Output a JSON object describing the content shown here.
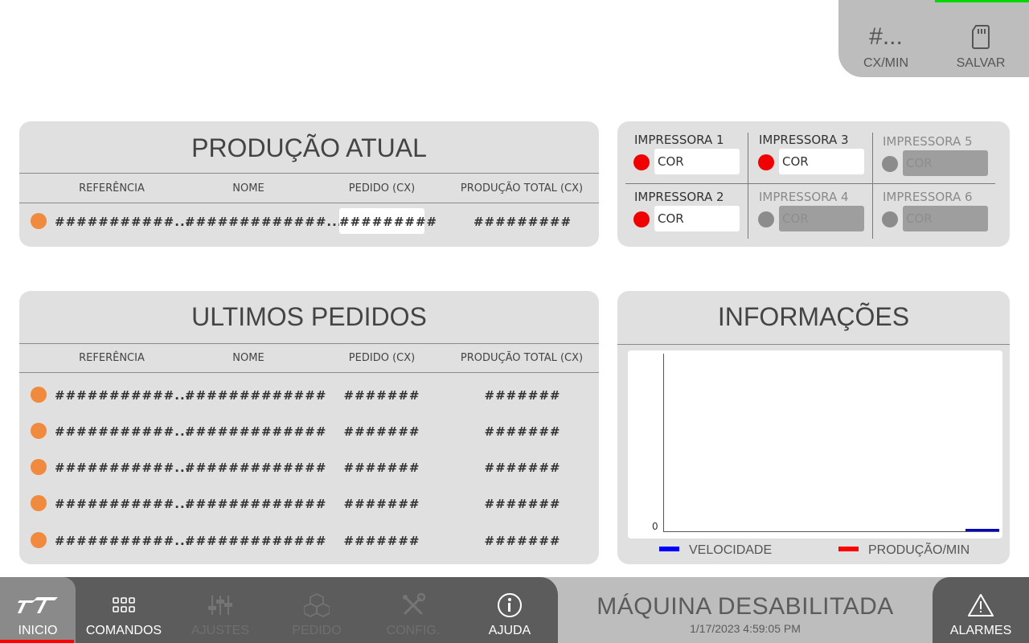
{
  "top": {
    "speed_value": "#...",
    "speed_label": "CX/MIN",
    "save_label": "SALVAR"
  },
  "producao_atual": {
    "title": "PRODUÇÃO ATUAL",
    "headers": [
      "REFERÊNCIA",
      "NOME",
      "PEDIDO (CX)",
      "PRODUÇÃO TOTAL (CX)"
    ],
    "row": {
      "referencia": "###########...",
      "nome": "#############...",
      "pedido": "#########",
      "total": "#########"
    }
  },
  "impressoras": [
    {
      "name": "IMPRESSORA 1",
      "cor": "COR",
      "enabled": true
    },
    {
      "name": "IMPRESSORA 2",
      "cor": "COR",
      "enabled": true
    },
    {
      "name": "IMPRESSORA 3",
      "cor": "COR",
      "enabled": true
    },
    {
      "name": "IMPRESSORA 4",
      "cor": "COR",
      "enabled": false
    },
    {
      "name": "IMPRESSORA 5",
      "cor": "COR",
      "enabled": false
    },
    {
      "name": "IMPRESSORA 6",
      "cor": "COR",
      "enabled": false
    }
  ],
  "ultimos_pedidos": {
    "title": "ULTIMOS PEDIDOS",
    "headers": [
      "REFERÊNCIA",
      "NOME",
      "PEDIDO (CX)",
      "PRODUÇÃO TOTAL (CX)"
    ],
    "rows": [
      {
        "referencia": "###########...",
        "nome": "#############",
        "pedido": "#######",
        "total": "#######"
      },
      {
        "referencia": "###########...",
        "nome": "#############",
        "pedido": "#######",
        "total": "#######"
      },
      {
        "referencia": "###########...",
        "nome": "#############",
        "pedido": "#######",
        "total": "#######"
      },
      {
        "referencia": "###########...",
        "nome": "#############",
        "pedido": "#######",
        "total": "#######"
      },
      {
        "referencia": "###########...",
        "nome": "#############",
        "pedido": "#######",
        "total": "#######"
      }
    ]
  },
  "informacoes": {
    "title": "INFORMAÇÕES",
    "y_tick": "0",
    "legend": [
      {
        "label": "VELOCIDADE",
        "color": "#0000ff"
      },
      {
        "label": "PRODUÇÃO/MIN",
        "color": "#ff0000"
      }
    ]
  },
  "nav": {
    "inicio": "INICIO",
    "comandos": "COMANDOS",
    "ajustes": "AJUSTES",
    "pedido": "PEDIDO",
    "config": "CONFIG.",
    "ajuda": "AJUDA"
  },
  "status": {
    "message": "MÁQUINA DESABILITADA",
    "datetime": "1/17/2023 4:59:05 PM"
  },
  "alarmes": "ALARMES",
  "colors": {
    "status_orange": "#f08a3e",
    "printer_active": "#f00000",
    "printer_inactive": "#8c8c8c",
    "active_tab_indicator": "#ff0000",
    "top_indicator": "#00d800"
  }
}
